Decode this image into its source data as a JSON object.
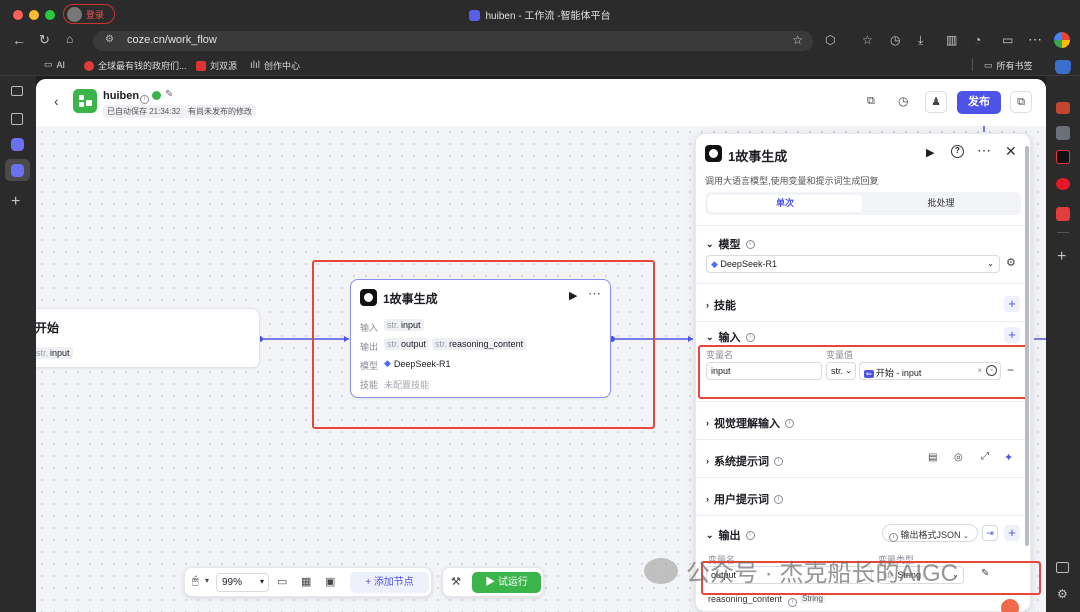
{
  "browser": {
    "window_title": "huiben - 工作流 -智能体平台",
    "profile_label": "登录",
    "url": "coze.cn/work_flow",
    "bookmarks": [
      "AI",
      "全球最有钱的政府们...",
      "刘双源",
      "创作中心"
    ],
    "all_bookmarks": "所有书签"
  },
  "header": {
    "name": "huiben",
    "autosave": "已自动保存 21:34:32",
    "unpublished": "有尚未发布的修改",
    "publish_label": "发布"
  },
  "start_node": {
    "title": "开始",
    "output_type": "str.",
    "output_name": "input"
  },
  "llm_node": {
    "title": "1故事生成",
    "input_label": "输入",
    "input_type": "str.",
    "input_name": "input",
    "output_label": "输出",
    "output1_type": "str.",
    "output1_name": "output",
    "output2_type": "str.",
    "output2_name": "reasoning_content",
    "model_label": "模型",
    "model_value": "DeepSeek-R1",
    "skill_label": "技能",
    "skill_value": "未配置技能"
  },
  "panel": {
    "title": "1故事生成",
    "description": "调用大语言模型,使用变量和提示词生成回复",
    "tab_single": "单次",
    "tab_batch": "批处理",
    "model_section": "模型",
    "model_value": "DeepSeek-R1",
    "skills_section": "技能",
    "input_section": "输入",
    "var_name_header": "变量名",
    "var_value_header": "变量值",
    "input_var_name": "input",
    "input_var_type": "str.",
    "input_ref": "开始 - input",
    "vision_section": "视觉理解输入",
    "system_prompt_section": "系统提示词",
    "user_prompt_section": "用户提示词",
    "output_section": "输出",
    "output_format": "输出格式JSON",
    "out_var_name_header": "变量名",
    "out_var_type_header": "变量类型",
    "output_var_name": "output",
    "output_var_type": "String",
    "output_var_prefix": "str.",
    "reasoning_name": "reasoning_content",
    "reasoning_type": "String"
  },
  "toolbar": {
    "zoom": "99%",
    "add_node": "添加节点",
    "test_run": "试运行"
  },
  "watermark": "公众号 · 杰克船长的AIGC",
  "colors": {
    "accent": "#4d53e8",
    "run_green": "#3bb54a",
    "highlight_red": "#e8453c"
  }
}
